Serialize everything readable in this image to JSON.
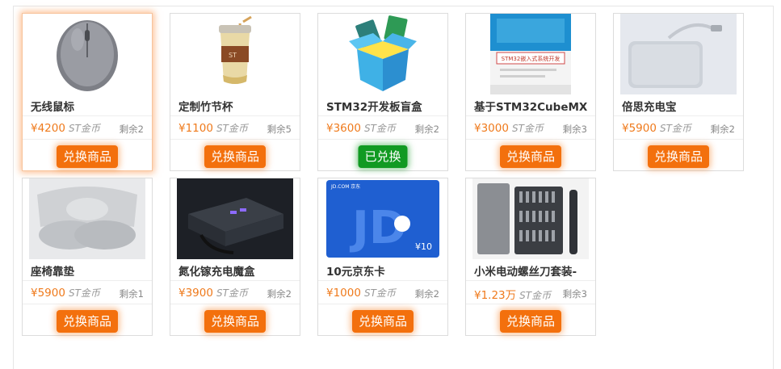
{
  "products": [
    {
      "name": "无线鼠标",
      "price": "¥4200",
      "unit": "ST金币",
      "stock": "剩余2",
      "button": "兑换商品",
      "state": "orange",
      "icon": "wireless-mouse-image"
    },
    {
      "name": "定制竹节杯",
      "price": "¥1100",
      "unit": "ST金币",
      "stock": "剩余5",
      "button": "兑换商品",
      "state": "orange",
      "icon": "bamboo-cup-image"
    },
    {
      "name": "STM32开发板盲盒",
      "price": "¥3600",
      "unit": "ST金币",
      "stock": "剩余2",
      "button": "已兑换",
      "state": "green",
      "icon": "blind-box-image"
    },
    {
      "name": "基于STM32CubeMX",
      "price": "¥3000",
      "unit": "ST金币",
      "stock": "剩余3",
      "button": "兑换商品",
      "state": "orange",
      "icon": "book-image"
    },
    {
      "name": "倍思充电宝",
      "price": "¥5900",
      "unit": "ST金币",
      "stock": "剩余2",
      "button": "兑换商品",
      "state": "orange",
      "icon": "power-bank-image"
    },
    {
      "name": "座椅靠垫",
      "price": "¥5900",
      "unit": "ST金币",
      "stock": "剩余1",
      "button": "兑换商品",
      "state": "orange",
      "icon": "seat-cushion-image"
    },
    {
      "name": "氮化镓充电魔盒",
      "price": "¥3900",
      "unit": "ST金币",
      "stock": "剩余2",
      "button": "兑换商品",
      "state": "orange",
      "icon": "gan-charger-image"
    },
    {
      "name": "10元京东卡",
      "price": "¥1000",
      "unit": "ST金币",
      "stock": "剩余2",
      "button": "兑换商品",
      "state": "orange",
      "icon": "jd-card-image",
      "card_text": {
        "brand": "JD.COM 京东",
        "amount": "¥10"
      }
    },
    {
      "name": "小米电动螺丝刀套装-",
      "price": "¥1.23万",
      "unit": "ST金币",
      "stock": "剩余3",
      "button": "兑换商品",
      "state": "orange",
      "icon": "screwdriver-kit-image"
    }
  ],
  "book_cover_text": "STM32嵌入式系统开发"
}
